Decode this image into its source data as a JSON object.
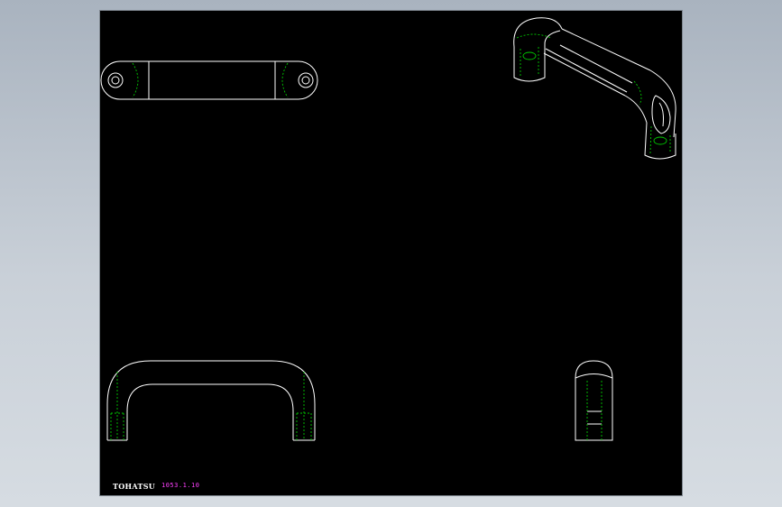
{
  "sheet": {
    "background": "#000000",
    "line_color": "#ffffff",
    "hidden_line_color": "#00c800"
  },
  "title_block": {
    "brand": "TOHATSU",
    "part_code": "1053.1.10",
    "brand_color": "#ffffff",
    "code_color": "#ff40ff"
  },
  "views": [
    "top-view",
    "isometric-view",
    "front-view",
    "side-view"
  ]
}
